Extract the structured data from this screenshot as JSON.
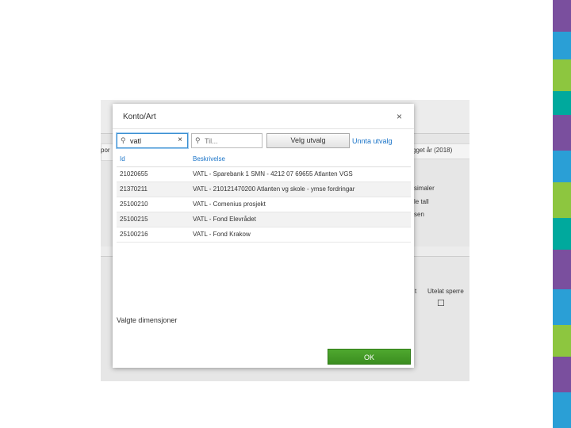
{
  "dialog": {
    "title": "Konto/Art",
    "close_label": "×",
    "search": {
      "value": "vatl",
      "clear_label": "×"
    },
    "to_field": {
      "placeholder": "Til..."
    },
    "select_button": "Velg utvalg",
    "except_link": "Unnta utvalg",
    "columns": [
      "Id",
      "Beskrivelse"
    ],
    "rows": [
      [
        "21020655",
        "VATL - Sparebank 1 SMN - 4212 07 69655 Atlanten VGS"
      ],
      [
        "21370211",
        "VATL - 210121470200 Atlanten vg skole - ymse fordringar"
      ],
      [
        "25100210",
        "VATL - Comenius prosjekt"
      ],
      [
        "25100215",
        "VATL - Fond Elevrådet"
      ],
      [
        "25100216",
        "VATL - Fond Krakow"
      ]
    ],
    "selected_dimensions_label": "Valgte dimensjoner",
    "ok_label": "OK"
  },
  "background": {
    "left_header": "por",
    "right_header": "gget år (2018)",
    "opt1": "simaler",
    "opt2": "le tall",
    "opt3": "sen",
    "col_t": "t",
    "col_excluded": "Utelat sperre",
    "checkbox_glyph": "☐"
  },
  "colors": {
    "accent": "#1a74c8",
    "ok": "#46a02a"
  }
}
